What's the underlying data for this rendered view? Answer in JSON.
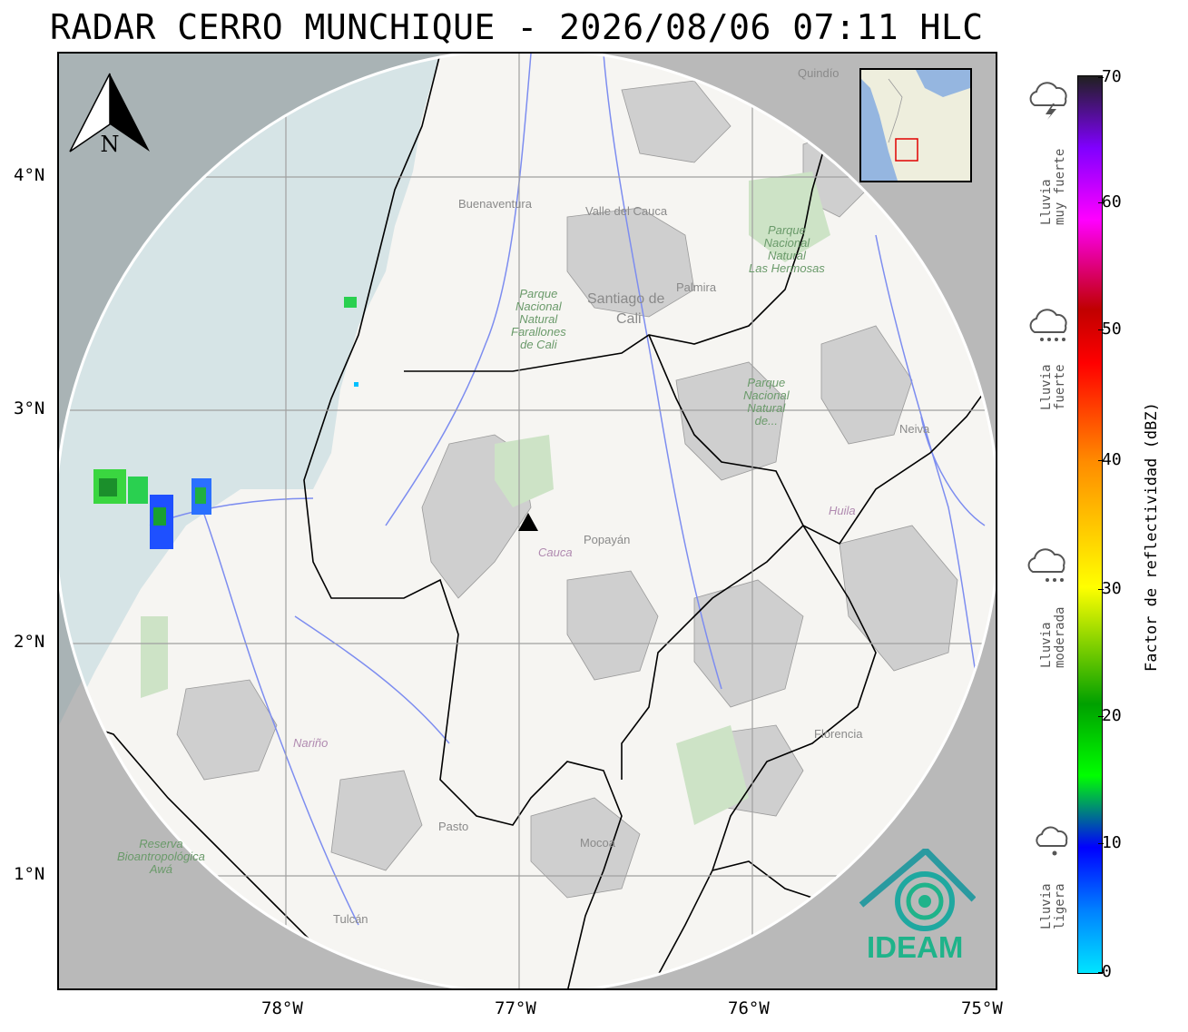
{
  "title": "RADAR CERRO MUNCHIQUE - 2026/08/06 07:11 HLC",
  "axes": {
    "lat_ticks": [
      "4°N",
      "3°N",
      "2°N",
      "1°N"
    ],
    "lon_ticks": [
      "78°W",
      "77°W",
      "76°W",
      "75°W"
    ]
  },
  "north_arrow": {
    "letter": "N"
  },
  "colorbar": {
    "label": "Factor de reflectividad (dBZ)",
    "ticks": [
      "70",
      "60",
      "50",
      "40",
      "30",
      "20",
      "10",
      "0"
    ],
    "range": [
      0,
      70
    ]
  },
  "rain_categories": [
    {
      "label": "Lluvia\nmuy fuerte",
      "icon": "storm-cloud-icon"
    },
    {
      "label": "Lluvia\nfuerte",
      "icon": "heavy-rain-cloud-icon"
    },
    {
      "label": "Lluvia\nmoderada",
      "icon": "rain-cloud-icon"
    },
    {
      "label": "Lluvia\nligera",
      "icon": "light-rain-cloud-icon"
    }
  ],
  "map_labels": {
    "cities": [
      "Buenaventura",
      "Valle del Cauca",
      "Palmira",
      "Santiago de",
      "Cali",
      "Popayán",
      "Neiva",
      "Florencia",
      "Pasto",
      "Mocoa",
      "Tulcán",
      "Quindío"
    ],
    "parks": [
      "Parque\nNacional\nNatural\nFarallones\nde Cali",
      "Parque\nNacional\nNatural\nLas Hermosas",
      "Parque\nNacional\nNatural\nde...",
      "Reserva\nBioantropológica\nAwá"
    ],
    "departments": [
      "Cauca",
      "Huila",
      "Nariño"
    ]
  },
  "logo": {
    "text": "IDEAM"
  },
  "colors": {
    "ocean": "#c9dde0",
    "land": "#f6f5f2",
    "outside_range": "#a8a8a8",
    "logo": "#1fb38a"
  }
}
